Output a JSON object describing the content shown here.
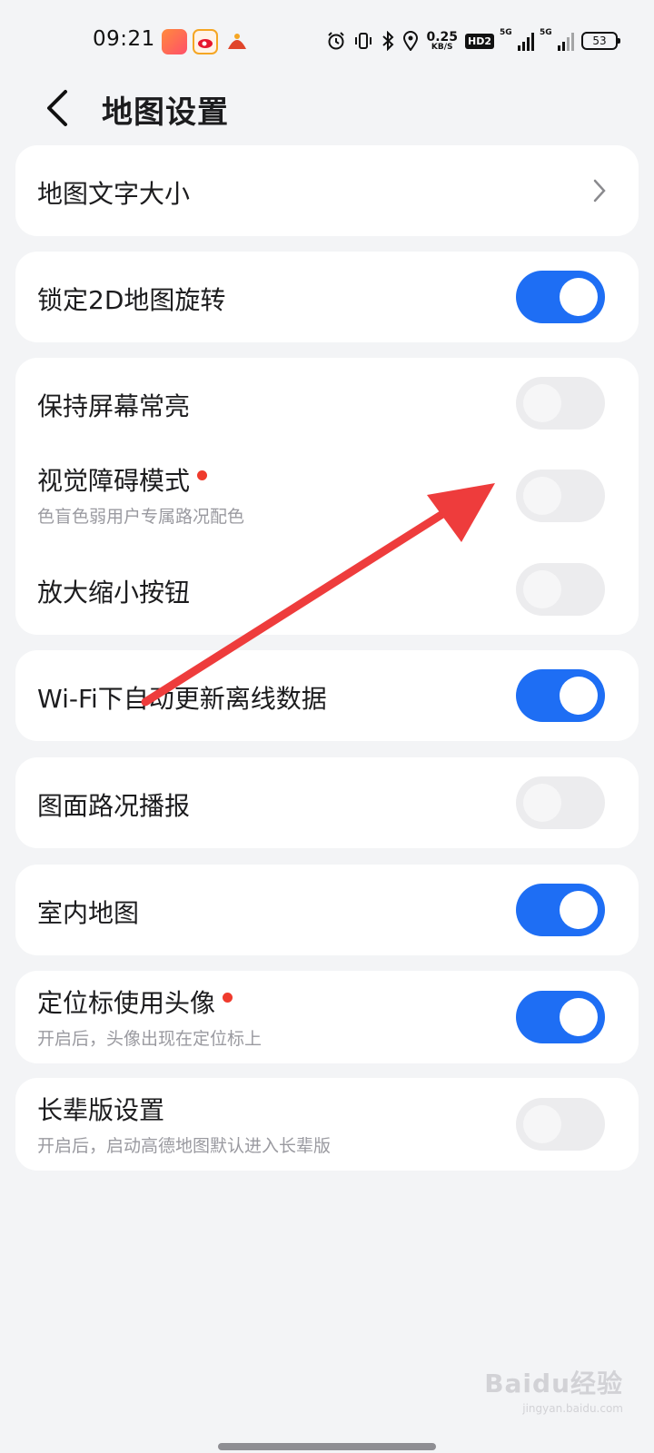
{
  "status_bar": {
    "time": "09:21",
    "net_speed_value": "0.25",
    "net_speed_unit": "KB/S",
    "hd_label": "HD2",
    "signal1_label": "5G",
    "signal2_label": "5G",
    "battery": "53"
  },
  "header": {
    "title": "地图设置"
  },
  "settings": {
    "map_text_size": {
      "label": "地图文字大小"
    },
    "lock_2d_rotation": {
      "label": "锁定2D地图旋转",
      "on": true
    },
    "keep_screen_on": {
      "label": "保持屏幕常亮",
      "on": false
    },
    "visual_impairment_mode": {
      "label": "视觉障碍模式",
      "subtitle": "色盲色弱用户专属路况配色",
      "on": false
    },
    "zoom_buttons": {
      "label": "放大缩小按钮",
      "on": false
    },
    "wifi_auto_update": {
      "label": "Wi-Fi下自动更新离线数据",
      "on": true
    },
    "map_traffic_broadcast": {
      "label": "图面路况播报",
      "on": false
    },
    "indoor_map": {
      "label": "室内地图",
      "on": true
    },
    "avatar_location_marker": {
      "label": "定位标使用头像",
      "subtitle": "开启后，头像出现在定位标上",
      "on": true
    },
    "elder_mode": {
      "label": "长辈版设置",
      "subtitle": "开启后，启动高德地图默认进入长辈版",
      "on": false
    }
  },
  "watermark": {
    "main": "Baidu经验",
    "sub": "jingyan.baidu.com"
  },
  "colors": {
    "toggle_on": "#1e6ef4",
    "toggle_off": "#ececee",
    "badge_dot": "#ef3b2d",
    "arrow": "#ee3c3c",
    "background": "#f3f4f6"
  }
}
